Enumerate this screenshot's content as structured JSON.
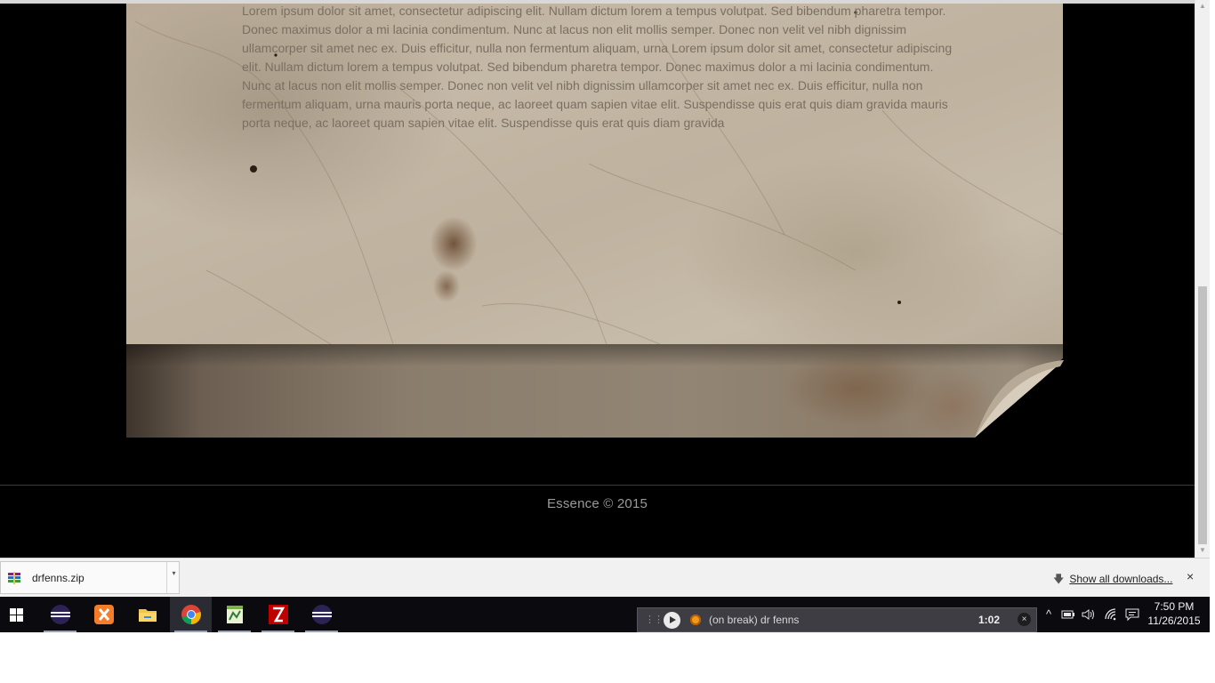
{
  "page": {
    "body_text": "Lorem ipsum dolor sit amet, consectetur adipiscing elit. Nullam dictum lorem a tempus volutpat. Sed bibendum pharetra tempor. Donec maximus dolor a mi lacinia condimentum. Nunc at lacus non elit mollis semper. Donec non velit vel nibh dignissim ullamcorper sit amet nec ex. Duis efficitur, nulla non fermentum aliquam, urna Lorem ipsum dolor sit amet, consectetur adipiscing elit. Nullam dictum lorem a tempus volutpat. Sed bibendum pharetra tempor. Donec maximus dolor a mi lacinia condimentum. Nunc at lacus non elit mollis semper. Donec non velit vel nibh dignissim ullamcorper sit amet nec ex. Duis efficitur, nulla non fermentum aliquam, urna mauris porta neque, ac laoreet quam sapien vitae elit. Suspendisse quis erat quis diam gravida mauris porta neque, ac laoreet quam sapien vitae elit. Suspendisse quis erat quis diam gravida",
    "footer": "Essence © 2015"
  },
  "download_shelf": {
    "item_name": "drfenns.zip",
    "show_all_label": "Show all downloads...",
    "close_label": "×"
  },
  "taskbar": {
    "apps": [
      "start-icon",
      "eclipse-icon",
      "xampp-icon",
      "file-explorer-icon",
      "chrome-icon",
      "notepad-plus-plus-icon",
      "filezilla-icon",
      "eclipse-icon"
    ],
    "media": {
      "title": "(on break) dr fenns",
      "time": "1:02",
      "close_label": "×"
    },
    "clock": {
      "time": "7:50 PM",
      "date": "11/26/2015"
    }
  },
  "colors": {
    "page_background": "#000000",
    "paper": "#c1b5a3",
    "text": "#7a6f61",
    "footer_text": "#9a9a9a",
    "taskbar": "#0b0b0f",
    "media_accent": "#f19a1c"
  }
}
